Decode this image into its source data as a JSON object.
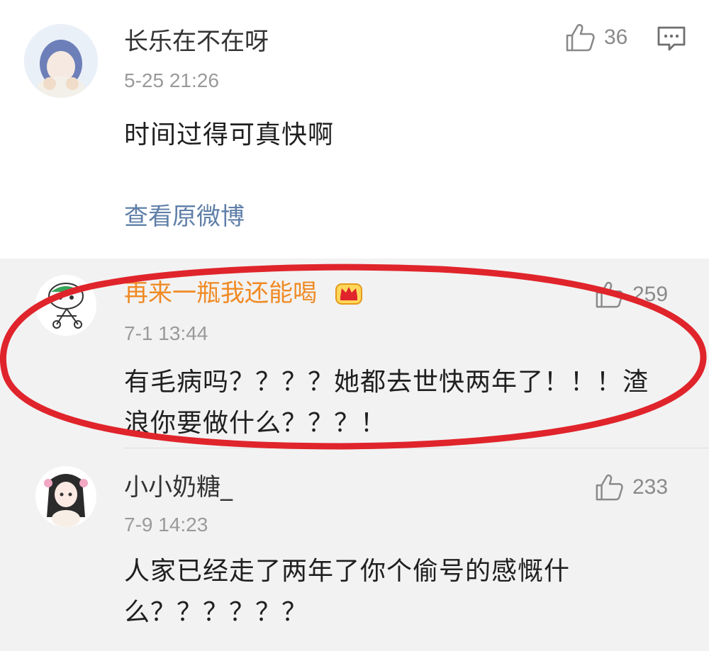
{
  "main_post": {
    "author": "长乐在不在呀",
    "time": "5-25 21:26",
    "text": "时间过得可真快啊",
    "likes": "36",
    "view_original": "查看原微博"
  },
  "replies": [
    {
      "author": "再来一瓶我还能喝",
      "time": "7-1 13:44",
      "text_line1": "有毛病吗？？？？她都去世快两年了！！！渣",
      "text_line2": "浪你要做什么？？？！",
      "likes": "259",
      "badge": "crown-icon"
    },
    {
      "author": "小小奶糖_",
      "time": "7-9 14:23",
      "text_line1": "人家已经走了两年了你个偷号的感慨什",
      "text_line2": "么？？？？？？",
      "likes": "233"
    }
  ],
  "colors": {
    "annotation_ellipse": "#e0242b",
    "vip_name": "#f08a24",
    "link": "#5f7fa8"
  }
}
